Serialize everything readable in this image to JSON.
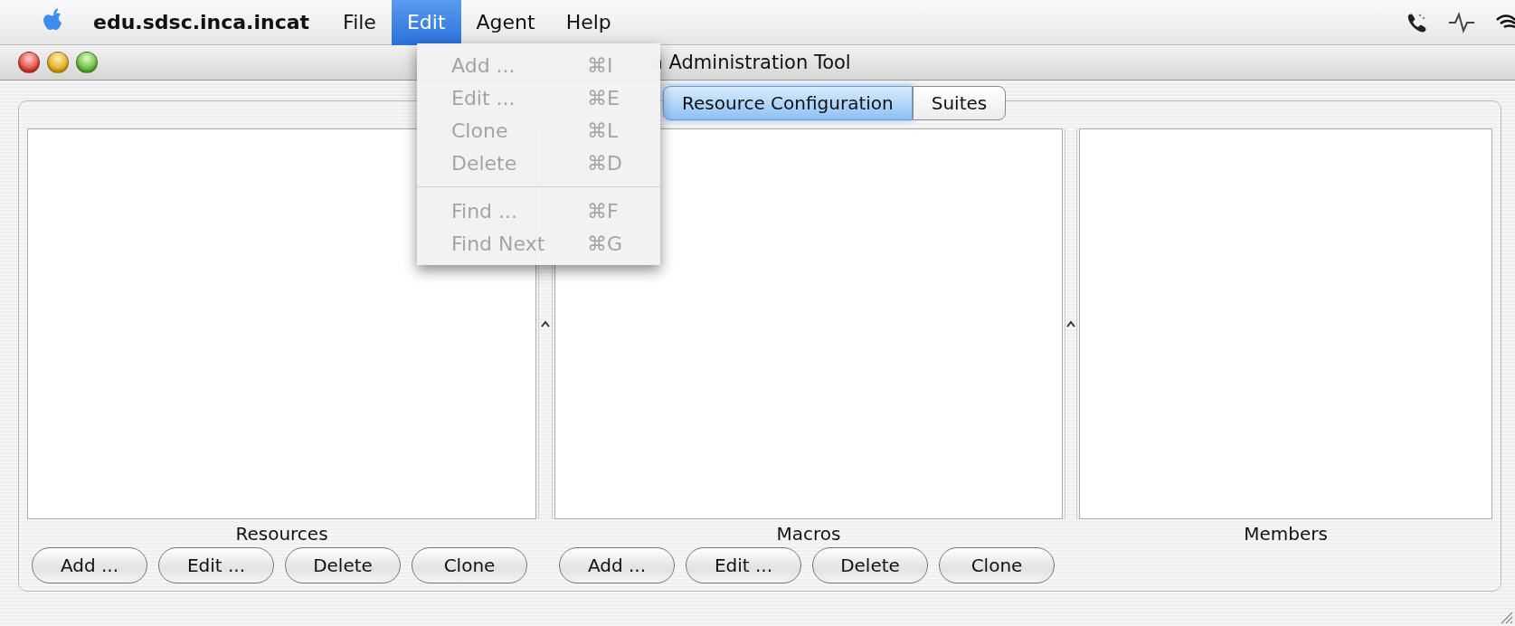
{
  "menu_bar": {
    "app_name": "edu.sdsc.inca.incat",
    "menus": [
      {
        "label": "File",
        "selected": false
      },
      {
        "label": "Edit",
        "selected": true
      },
      {
        "label": "Agent",
        "selected": false
      },
      {
        "label": "Help",
        "selected": false
      }
    ]
  },
  "edit_menu": {
    "items": [
      {
        "kind": "item",
        "label": "Add ...",
        "shortcut": "⌘I",
        "disabled": true
      },
      {
        "kind": "item",
        "label": "Edit ...",
        "shortcut": "⌘E",
        "disabled": true
      },
      {
        "kind": "item",
        "label": "Clone",
        "shortcut": "⌘L",
        "disabled": true
      },
      {
        "kind": "item",
        "label": "Delete",
        "shortcut": "⌘D",
        "disabled": true
      },
      {
        "kind": "separator"
      },
      {
        "kind": "item",
        "label": "Find ...",
        "shortcut": "⌘F",
        "disabled": true
      },
      {
        "kind": "item",
        "label": "Find Next",
        "shortcut": "⌘G",
        "disabled": true
      }
    ]
  },
  "window": {
    "title": "a Administration Tool"
  },
  "tabs": [
    {
      "label": "Resource Configuration",
      "selected": true
    },
    {
      "label": "Suites",
      "selected": false
    }
  ],
  "panes": [
    {
      "label": "Resources",
      "buttons": [
        "Add ...",
        "Edit ...",
        "Delete",
        "Clone"
      ]
    },
    {
      "label": "Macros",
      "buttons": [
        "Add ...",
        "Edit ...",
        "Delete",
        "Clone"
      ]
    },
    {
      "label": "Members"
    }
  ]
}
